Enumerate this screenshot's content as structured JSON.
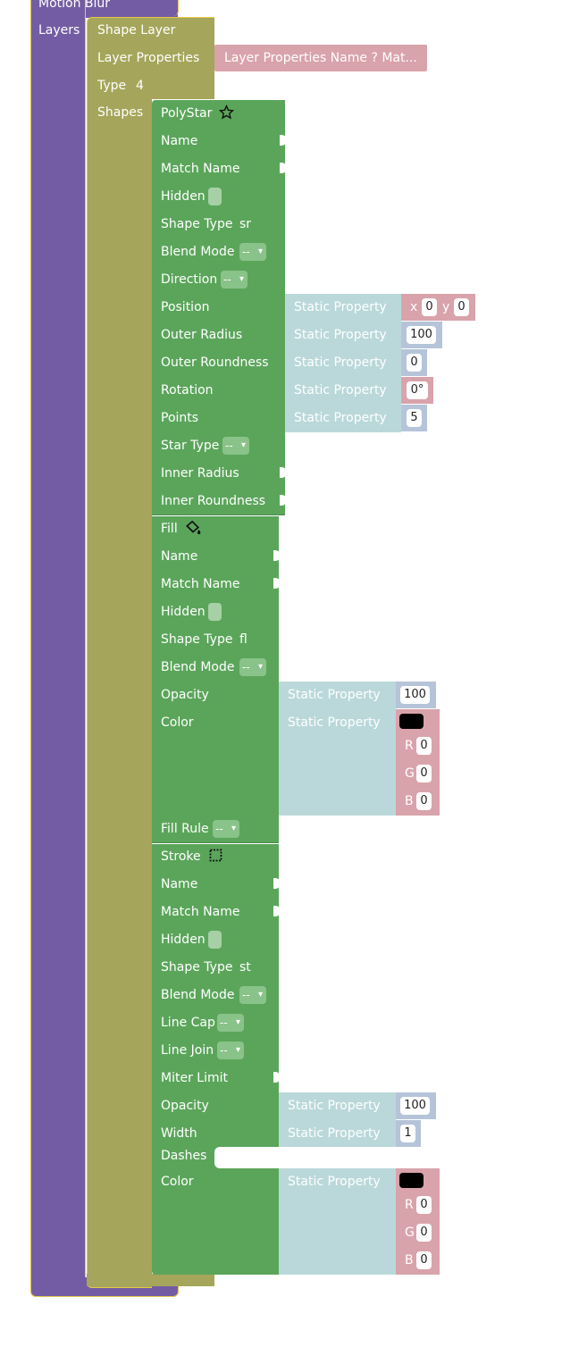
{
  "motion_blur_label": "Motion Blur",
  "layers_label": "Layers",
  "shape_layer": {
    "title": "Shape Layer",
    "layer_properties_label": "Layer Properties",
    "layer_properties_value": "Layer Properties Name ? Mat...",
    "type_label": "Type",
    "type_value": "4",
    "shapes_label": "Shapes"
  },
  "polystar": {
    "title": "PolyStar",
    "icon": "star-icon",
    "name": "Name",
    "match_name": "Match Name",
    "hidden": "Hidden",
    "shape_type_label": "Shape Type",
    "shape_type_value": "sr",
    "blend_mode": "Blend Mode",
    "direction": "Direction",
    "position": "Position",
    "outer_radius": "Outer Radius",
    "outer_roundness": "Outer Roundness",
    "rotation": "Rotation",
    "points": "Points",
    "star_type": "Star Type",
    "inner_radius": "Inner Radius",
    "inner_roundness": "Inner Roundness",
    "static_property": "Static Property",
    "position_x_label": "x",
    "position_x": "0",
    "position_y_label": "y",
    "position_y": "0",
    "outer_radius_value": "100",
    "outer_roundness_value": "0",
    "rotation_value": "0°",
    "points_value": "5"
  },
  "fill": {
    "title": "Fill",
    "icon": "paint-bucket-icon",
    "name": "Name",
    "match_name": "Match Name",
    "hidden": "Hidden",
    "shape_type_label": "Shape Type",
    "shape_type_value": "fl",
    "blend_mode": "Blend Mode",
    "opacity": "Opacity",
    "color": "Color",
    "fill_rule": "Fill Rule",
    "static_property": "Static Property",
    "opacity_value": "100",
    "r_label": "R",
    "r_value": "0",
    "g_label": "G",
    "g_value": "0",
    "b_label": "B",
    "b_value": "0",
    "swatch": "#000000"
  },
  "stroke": {
    "title": "Stroke",
    "icon": "stroke-square-icon",
    "name": "Name",
    "match_name": "Match Name",
    "hidden": "Hidden",
    "shape_type_label": "Shape Type",
    "shape_type_value": "st",
    "blend_mode": "Blend Mode",
    "line_cap": "Line Cap",
    "line_join": "Line Join",
    "miter_limit": "Miter Limit",
    "opacity": "Opacity",
    "width": "Width",
    "dashes": "Dashes",
    "color": "Color",
    "static_property": "Static Property",
    "opacity_value": "100",
    "width_value": "1",
    "r_label": "R",
    "r_value": "0",
    "g_label": "G",
    "g_value": "0",
    "b_label": "B",
    "b_value": "0",
    "swatch": "#000000"
  },
  "dropdown_value": "--",
  "dropdown_arrow": "▾"
}
